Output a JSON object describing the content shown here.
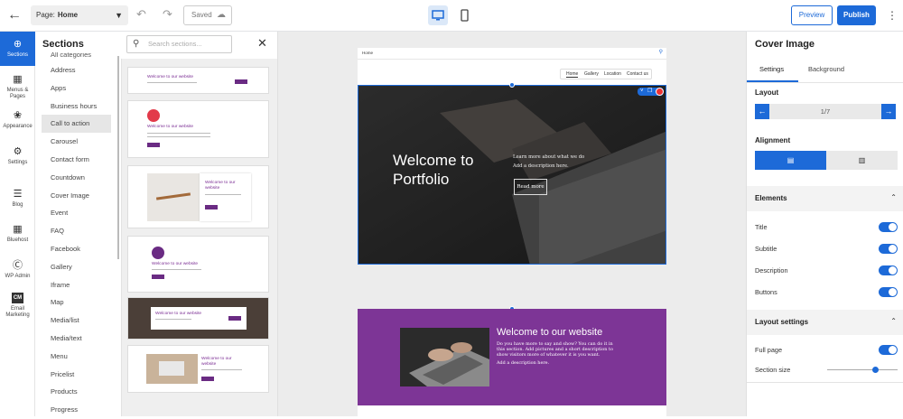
{
  "topbar": {
    "page_label": "Page:",
    "page_value": "Home",
    "saved_label": "Saved",
    "preview_label": "Preview",
    "publish_label": "Publish"
  },
  "rail": [
    {
      "label": "Sections",
      "icon": "plus-circle-icon"
    },
    {
      "label": "Menus & Pages",
      "icon": "pages-icon"
    },
    {
      "label": "Appearance",
      "icon": "palette-icon"
    },
    {
      "label": "Settings",
      "icon": "gear-icon"
    },
    {
      "label": "Blog",
      "icon": "blog-icon"
    },
    {
      "label": "Bluehost",
      "icon": "grid-icon"
    },
    {
      "label": "WP Admin",
      "icon": "wordpress-icon"
    },
    {
      "label": "Email Marketing",
      "icon": "cm-icon"
    }
  ],
  "sections_panel": {
    "title": "Sections",
    "search_placeholder": "Search sections...",
    "categories": [
      "All categories",
      "Address",
      "Apps",
      "Business hours",
      "Call to action",
      "Carousel",
      "Contact form",
      "Countdown",
      "Cover Image",
      "Event",
      "FAQ",
      "Facebook",
      "Gallery",
      "Iframe",
      "Map",
      "Media/list",
      "Media/text",
      "Menu",
      "Pricelist",
      "Products",
      "Progress"
    ],
    "selected_category": "Call to action"
  },
  "thumbnails": {
    "heading": "Welcome to our website",
    "heading_split_1": "Welcome to our",
    "heading_split_2": "website"
  },
  "preview": {
    "nav_home": "Home",
    "nav_links": [
      "Home",
      "Gallery",
      "Location",
      "Contact us"
    ],
    "hero_title": "Welcome to Portfolio",
    "hero_subtitle": "Learn more about what we do",
    "hero_description": "Add a description here.",
    "hero_button": "Read more",
    "purple_title": "Welcome to our website",
    "purple_text": "Do you have more to say and show? You can do it in this section. Add pictures and a short description to show visitors more of whatever it is you want.",
    "purple_desc": "Add a description here."
  },
  "right_panel": {
    "title": "Cover Image",
    "tabs": [
      "Settings",
      "Background"
    ],
    "layout_label": "Layout",
    "layout_value": "1/7",
    "alignment_label": "Alignment",
    "elements_label": "Elements",
    "elements": [
      {
        "label": "Title",
        "on": true
      },
      {
        "label": "Subtitle",
        "on": true
      },
      {
        "label": "Description",
        "on": true
      },
      {
        "label": "Buttons",
        "on": true
      }
    ],
    "layout_settings_label": "Layout settings",
    "full_page_label": "Full page",
    "full_page_on": true,
    "section_size_label": "Section size",
    "section_size_fraction": 0.66
  },
  "colors": {
    "accent": "#1d6ad8",
    "purple": "#7d3596",
    "delete": "#e33333"
  }
}
